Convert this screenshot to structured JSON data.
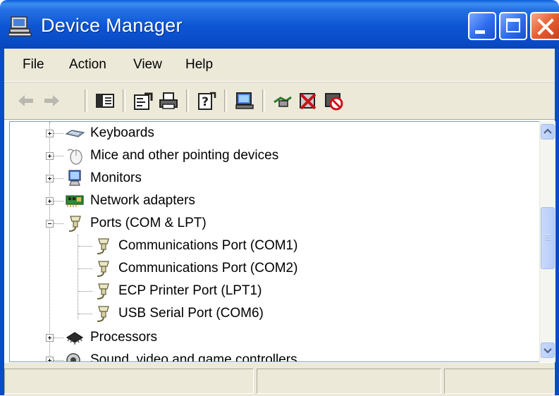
{
  "window": {
    "title": "Device Manager",
    "titlebar_color": "#0a4cc8",
    "close_color": "#e75d32"
  },
  "menu": {
    "file": "File",
    "action": "Action",
    "view": "View",
    "help": "Help"
  },
  "toolbar": {
    "buttons": [
      "back-arrow-icon",
      "forward-arrow-icon",
      "show-hide-tree-icon",
      "properties-icon",
      "print-icon",
      "help-icon",
      "scan-hardware-icon",
      "update-driver-icon",
      "uninstall-icon",
      "disable-icon"
    ]
  },
  "tree": {
    "items": [
      {
        "label": "Keyboards",
        "icon": "keyboard-icon",
        "expander": "plus"
      },
      {
        "label": "Mice and other pointing devices",
        "icon": "mouse-icon",
        "expander": "plus"
      },
      {
        "label": "Monitors",
        "icon": "monitor-icon",
        "expander": "plus"
      },
      {
        "label": "Network adapters",
        "icon": "network-adapter-icon",
        "expander": "plus"
      },
      {
        "label": "Ports (COM & LPT)",
        "icon": "port-icon",
        "expander": "minus"
      },
      {
        "label": "Communications Port (COM1)",
        "icon": "port-icon",
        "expander": "none"
      },
      {
        "label": "Communications Port (COM2)",
        "icon": "port-icon",
        "expander": "none"
      },
      {
        "label": "ECP Printer Port (LPT1)",
        "icon": "port-icon",
        "expander": "none"
      },
      {
        "label": "USB Serial Port (COM6)",
        "icon": "port-icon",
        "expander": "none"
      },
      {
        "label": "Processors",
        "icon": "processor-icon",
        "expander": "plus"
      },
      {
        "label": "Sound, video and game controllers",
        "icon": "sound-icon",
        "expander": "plus"
      }
    ]
  }
}
